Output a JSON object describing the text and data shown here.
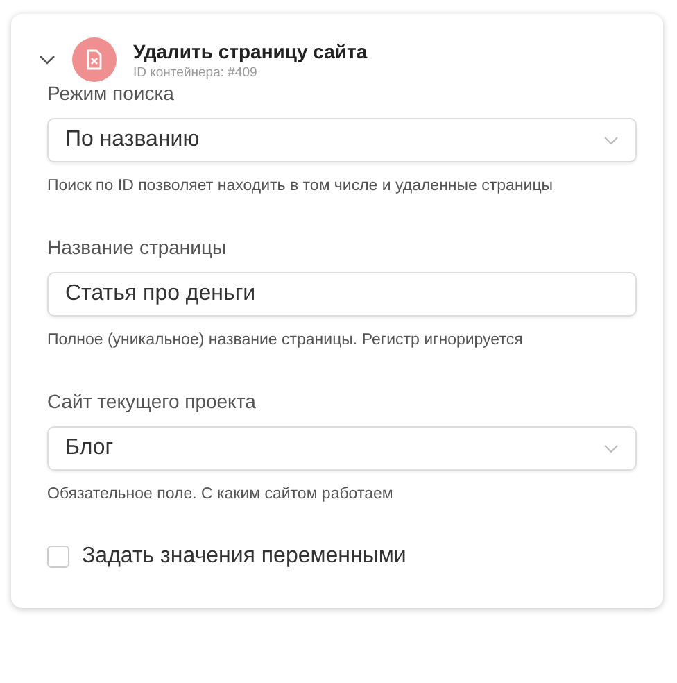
{
  "header": {
    "title": "Удалить страницу сайта",
    "subtitle": "ID контейнера: #409",
    "expanded": true
  },
  "fields": [
    {
      "kind": "select",
      "label": "Режим поиска",
      "value": "По названию",
      "hint": "Поиск по ID позволяет находить в том числе и удаленные страницы"
    },
    {
      "kind": "input",
      "label": "Название страницы",
      "value": "Статья про деньги",
      "hint": "Полное (уникальное) название страницы. Регистр игнорируется"
    },
    {
      "kind": "select",
      "label": "Сайт текущего проекта",
      "value": "Блог",
      "hint": "Обязательное поле. С каким сайтом работаем"
    }
  ],
  "checkbox": {
    "label": "Задать значения переменными",
    "checked": false
  }
}
